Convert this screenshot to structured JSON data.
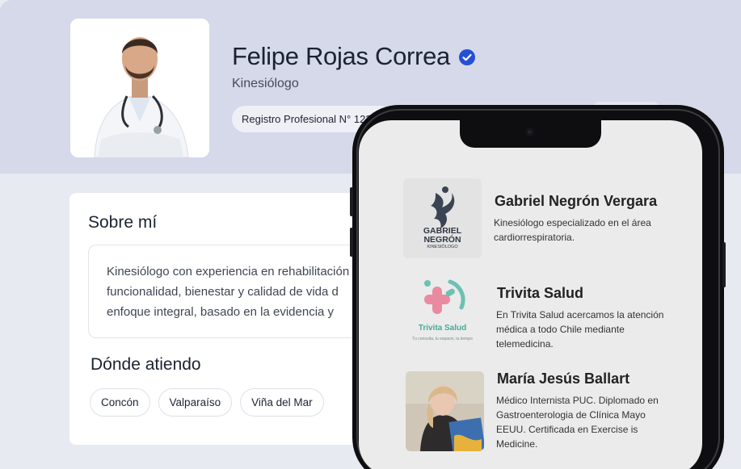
{
  "profile": {
    "name": "Felipe Rojas Correa",
    "profession": "Kinesiólogo",
    "registry": "Registro Profesional N° 123",
    "accent_color": "#2450d6"
  },
  "about": {
    "title": "Sobre mí",
    "lines": [
      "Kinesiólogo con experiencia en rehabilitación",
      "funcionalidad, bienestar y calidad de vida d",
      "enfoque integral, basado en la evidencia y"
    ]
  },
  "locations": {
    "title": "Dónde atiendo",
    "items": [
      "Concón",
      "Valparaíso",
      "Viña del Mar"
    ]
  },
  "phone_list": [
    {
      "name": "Gabriel Negrón Vergara",
      "logo_text_1": "GABRIEL",
      "logo_text_2": "NEGRÓN",
      "logo_text_3": "KINESIÓLOGO",
      "desc": [
        "Kinesiólogo especializado en el área",
        "cardiorrespiratoria."
      ]
    },
    {
      "name": "Trivita Salud",
      "logo_text_1": "Trivita Salud",
      "logo_text_2": "Tu consulta, tu espacio, tu tiempo",
      "desc": [
        "En Trivita Salud acercamos la atención",
        "médica a todo Chile mediante",
        "telemedicina."
      ]
    },
    {
      "name": "María Jesús Ballart",
      "desc": [
        "Médico Internista PUC. Diplomado en",
        "Gastroenterologia de Clínica Mayo",
        "EEUU. Certificada en Exercise is",
        "Medicine."
      ]
    }
  ]
}
